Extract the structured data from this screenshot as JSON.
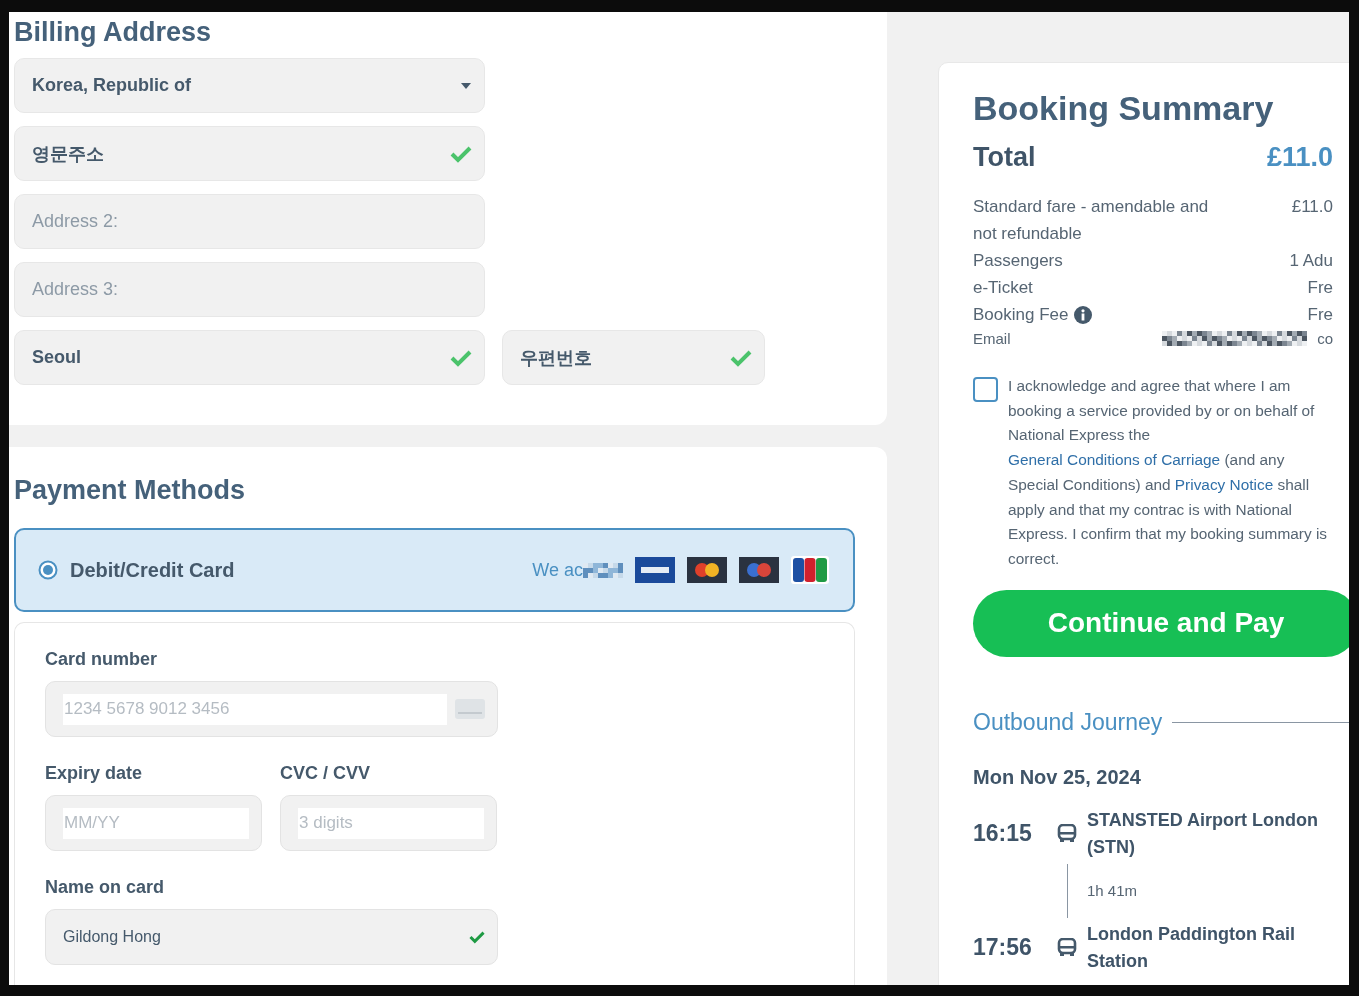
{
  "billing": {
    "heading": "Billing Address",
    "rows": [
      [
        {
          "kind": "select",
          "value": "Korea, Republic of"
        }
      ],
      [
        {
          "kind": "text",
          "value": "영문주소",
          "valid": true
        }
      ],
      [
        {
          "kind": "text",
          "placeholder": "Address 2:",
          "valid": false
        }
      ],
      [
        {
          "kind": "text",
          "placeholder": "Address 3:",
          "valid": false
        }
      ],
      [
        {
          "kind": "text",
          "value": "Seoul",
          "valid": true
        },
        {
          "kind": "text",
          "value": "우편번호",
          "valid": true
        }
      ]
    ]
  },
  "payment": {
    "heading": "Payment Methods",
    "methods": [
      {
        "label": "Debit/Credit Card",
        "selected": true,
        "accept_text": "We ac"
      }
    ],
    "card_form": [
      {
        "kind": "wide",
        "label": "Card number",
        "placeholder": "1234 5678 9012 3456"
      },
      {
        "kind": "pair",
        "fields": [
          {
            "label": "Expiry date",
            "placeholder": "MM/YY"
          },
          {
            "label": "CVC / CVV",
            "placeholder": "3 digits"
          }
        ]
      },
      {
        "kind": "name",
        "label": "Name on card",
        "value": "Gildong Hong",
        "valid": true
      }
    ]
  },
  "summary": {
    "title": "Booking Summary",
    "total_label": "Total",
    "total_value": "£11.0",
    "lines": [
      {
        "label": "Standard fare - amendable and not refundable",
        "value": "£11.0",
        "info": false
      },
      {
        "label": "Passengers",
        "value": "1 Adu",
        "info": false
      },
      {
        "label": "e-Ticket",
        "value": "Fre",
        "info": false
      },
      {
        "label": "Booking Fee",
        "value": "Fre",
        "info": true
      }
    ],
    "email": {
      "label": "Email",
      "value": "co"
    },
    "consent": {
      "checked": false,
      "segments": [
        {
          "kind": "text",
          "text": "I acknowledge and agree that where I am booking a service provided by or on behalf of National Express the "
        },
        {
          "kind": "link",
          "text": "General Conditions of Carriage"
        },
        {
          "kind": "text",
          "text": " (and any Special Conditions) and "
        },
        {
          "kind": "link",
          "text": "Privacy Notice"
        },
        {
          "kind": "text",
          "text": " shall apply and that my contrac is with National Express. I confirm that my booking summary is correct."
        }
      ]
    },
    "button": "Continue and Pay",
    "journey": {
      "heading": "Outbound Journey",
      "date": "Mon Nov 25, 2024",
      "duration": "1h 41m",
      "stops": [
        {
          "time": "16:15",
          "place": "STANSTED Airport London (STN)"
        },
        {
          "time": "17:56",
          "place": "London Paddington Rail Station"
        }
      ]
    }
  }
}
